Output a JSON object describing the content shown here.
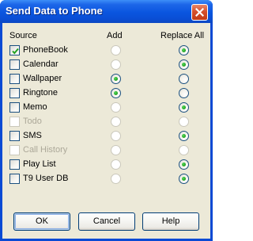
{
  "window": {
    "title": "Send Data to Phone",
    "close_glyph": "close-icon"
  },
  "columns": {
    "source": "Source",
    "add": "Add",
    "replace_all": "Replace All"
  },
  "rows": [
    {
      "label": "PhoneBook",
      "checked": true,
      "enabled": true,
      "add_enabled": false,
      "add_selected": false,
      "replace_enabled": true,
      "replace_selected": true
    },
    {
      "label": "Calendar",
      "checked": false,
      "enabled": true,
      "add_enabled": false,
      "add_selected": false,
      "replace_enabled": true,
      "replace_selected": true
    },
    {
      "label": "Wallpaper",
      "checked": false,
      "enabled": true,
      "add_enabled": true,
      "add_selected": true,
      "replace_enabled": true,
      "replace_selected": false
    },
    {
      "label": "Ringtone",
      "checked": false,
      "enabled": true,
      "add_enabled": true,
      "add_selected": true,
      "replace_enabled": true,
      "replace_selected": false
    },
    {
      "label": "Memo",
      "checked": false,
      "enabled": true,
      "add_enabled": false,
      "add_selected": false,
      "replace_enabled": true,
      "replace_selected": true
    },
    {
      "label": "Todo",
      "checked": false,
      "enabled": false,
      "add_enabled": false,
      "add_selected": false,
      "replace_enabled": false,
      "replace_selected": false
    },
    {
      "label": "SMS",
      "checked": false,
      "enabled": true,
      "add_enabled": false,
      "add_selected": false,
      "replace_enabled": true,
      "replace_selected": true
    },
    {
      "label": "Call History",
      "checked": false,
      "enabled": false,
      "add_enabled": false,
      "add_selected": false,
      "replace_enabled": false,
      "replace_selected": false
    },
    {
      "label": "Play List",
      "checked": false,
      "enabled": true,
      "add_enabled": false,
      "add_selected": false,
      "replace_enabled": true,
      "replace_selected": true
    },
    {
      "label": "T9 User DB",
      "checked": false,
      "enabled": true,
      "add_enabled": false,
      "add_selected": false,
      "replace_enabled": true,
      "replace_selected": true
    }
  ],
  "buttons": {
    "ok": "OK",
    "cancel": "Cancel",
    "help": "Help"
  },
  "colors": {
    "title_bar": "#0a55df",
    "dialog_face": "#ece9d8",
    "radio_dot": "#21a121",
    "checkmark": "#21a121",
    "disabled_text": "#aca899"
  }
}
